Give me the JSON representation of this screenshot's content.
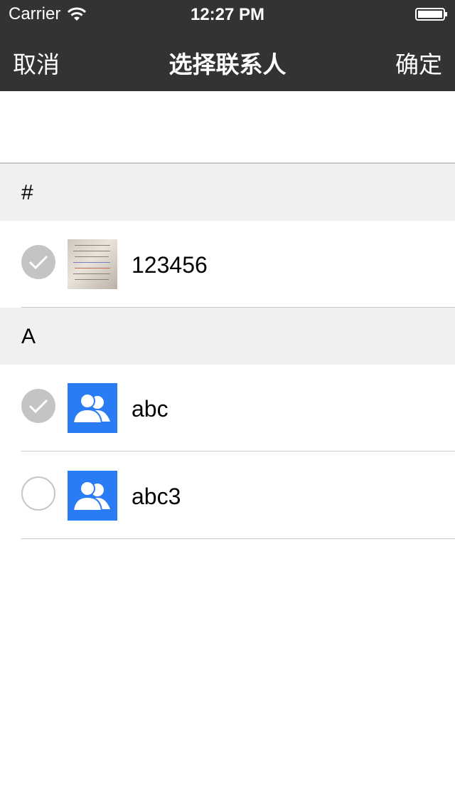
{
  "status_bar": {
    "carrier": "Carrier",
    "time": "12:27 PM"
  },
  "nav": {
    "cancel_label": "取消",
    "title": "选择联系人",
    "confirm_label": "确定"
  },
  "sections": [
    {
      "header": "#",
      "items": [
        {
          "name": "123456",
          "checked": true,
          "avatar": "photo"
        }
      ]
    },
    {
      "header": "A",
      "items": [
        {
          "name": "abc",
          "checked": true,
          "avatar": "default-contact-icon"
        },
        {
          "name": "abc3",
          "checked": false,
          "avatar": "default-contact-icon"
        }
      ]
    }
  ],
  "colors": {
    "nav_bg": "#333333",
    "avatar_blue": "#2a7cf5",
    "section_bg": "#f0f0f0",
    "check_gray": "#c4c4c4"
  }
}
